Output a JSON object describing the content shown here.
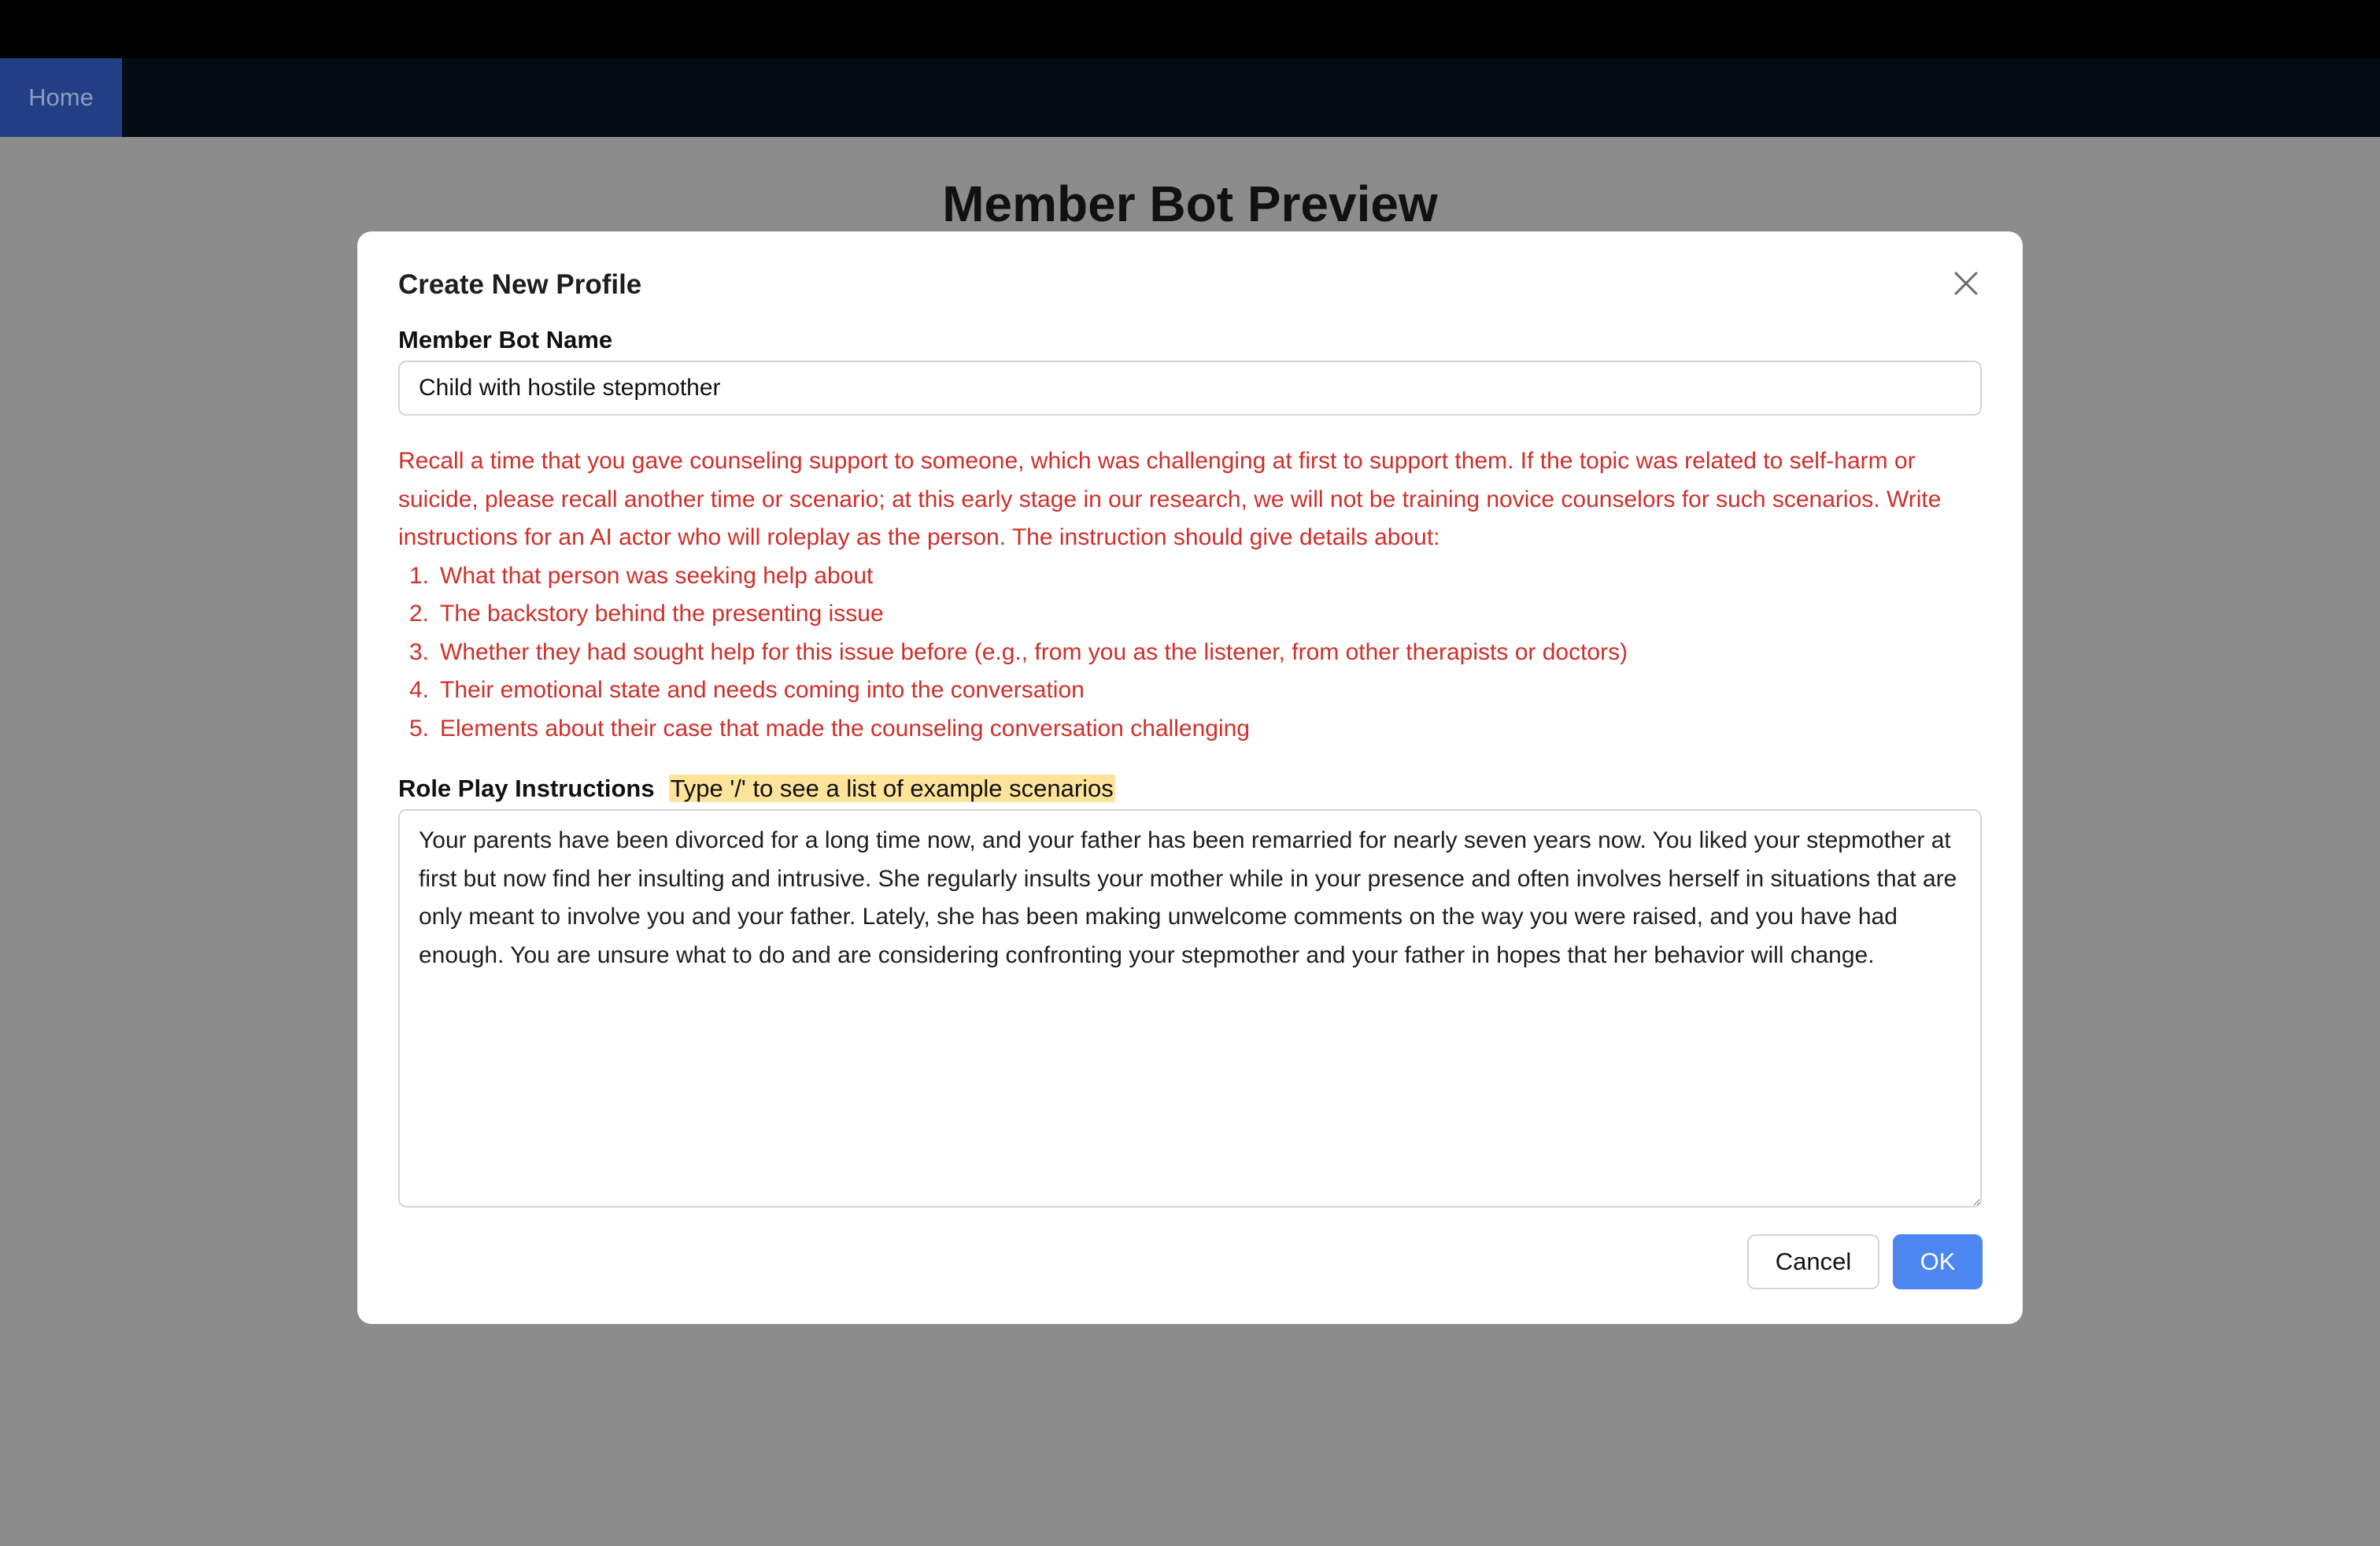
{
  "navbar": {
    "home_label": "Home"
  },
  "page": {
    "title": "Member Bot Preview"
  },
  "modal": {
    "title": "Create New Profile",
    "close_icon": "close-icon",
    "name_label": "Member Bot Name",
    "name_value": "Child with hostile stepmother",
    "instructions_intro": "Recall a time that you gave counseling support to someone, which was challenging at first to support them. If the topic was related to self-harm or suicide, please recall another time or scenario; at this early stage in our research, we will not be training novice counselors for such scenarios. Write instructions for an AI actor who will roleplay as the person. The instruction should give details about:",
    "instruction_items": [
      "What that person was seeking help about",
      "The backstory behind the presenting issue",
      "Whether they had sought help for this issue before (e.g., from you as the listener, from other therapists or doctors)",
      "Their emotional state and needs coming into the conversation",
      "Elements about their case that made the counseling conversation challenging"
    ],
    "roleplay_label": "Role Play Instructions",
    "roleplay_hint": "Type '/' to see a list of example scenarios",
    "roleplay_value": "Your parents have been divorced for a long time now, and your father has been remarried for nearly seven years now. You liked your stepmother at first but now find her insulting and intrusive. She regularly insults your mother while in your presence and often involves herself in situations that are only meant to involve you and your father. Lately, she has been making unwelcome comments on the way you were raised, and you have had enough. You are unsure what to do and are considering confronting your stepmother and your father in hopes that her behavior will change.",
    "cancel_label": "Cancel",
    "ok_label": "OK"
  },
  "colors": {
    "instruction_text": "#d02f2a",
    "hint_highlight": "#fde49a",
    "ok_button": "#4c86f0",
    "home_tab": "#223f86"
  }
}
